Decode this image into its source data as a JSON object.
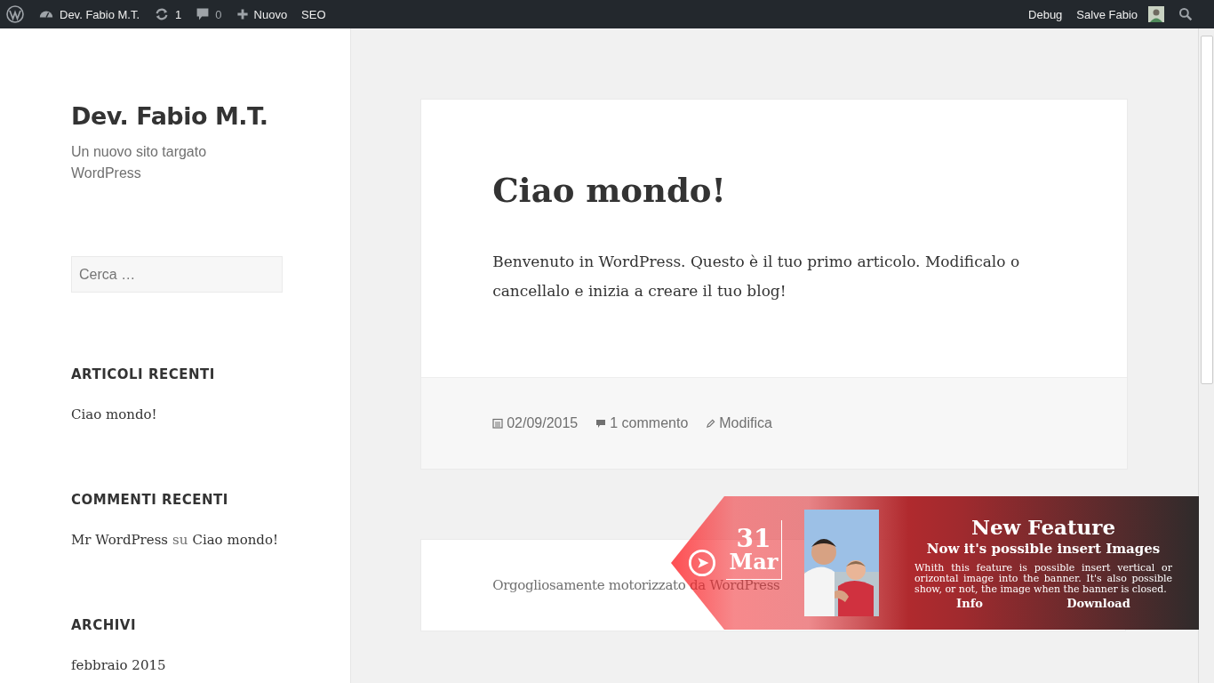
{
  "admin_bar": {
    "site_name": "Dev. Fabio M.T.",
    "updates": "1",
    "comments": "0",
    "new_label": "Nuovo",
    "seo_label": "SEO",
    "debug_label": "Debug",
    "greeting": "Salve Fabio"
  },
  "sidebar": {
    "site_title": "Dev. Fabio M.T.",
    "tagline": "Un nuovo sito targato WordPress",
    "search": {
      "placeholder": "Cerca …"
    },
    "widgets": [
      {
        "title": "ARTICOLI RECENTI",
        "items": [
          {
            "kind": "link",
            "text": "Ciao mondo!"
          }
        ]
      },
      {
        "title": "COMMENTI RECENTI",
        "items": [
          {
            "kind": "comment",
            "author": "Mr WordPress",
            "joiner": "su",
            "post": "Ciao mondo!"
          }
        ]
      },
      {
        "title": "ARCHIVI",
        "items": [
          {
            "kind": "link",
            "text": "febbraio 2015"
          }
        ]
      }
    ]
  },
  "post": {
    "title": "Ciao mondo!",
    "body": "Benvenuto in WordPress. Questo è il tuo primo articolo. Modificalo o cancellalo e inizia a creare il tuo blog!",
    "date": "02/09/2015",
    "comments": "1 commento",
    "edit": "Modifica"
  },
  "footer": {
    "text": "Orgogliosamente motorizzato da WordPress"
  },
  "banner": {
    "day": "31",
    "month": "Mar",
    "title": "New Feature",
    "subtitle": "Now it's possible insert Images",
    "body": "Whith this feature is possible insert vertical or orizontal image into the banner. It's also possible show, or not, the image when the banner is closed.",
    "buttons": [
      "Info",
      "Download"
    ]
  }
}
